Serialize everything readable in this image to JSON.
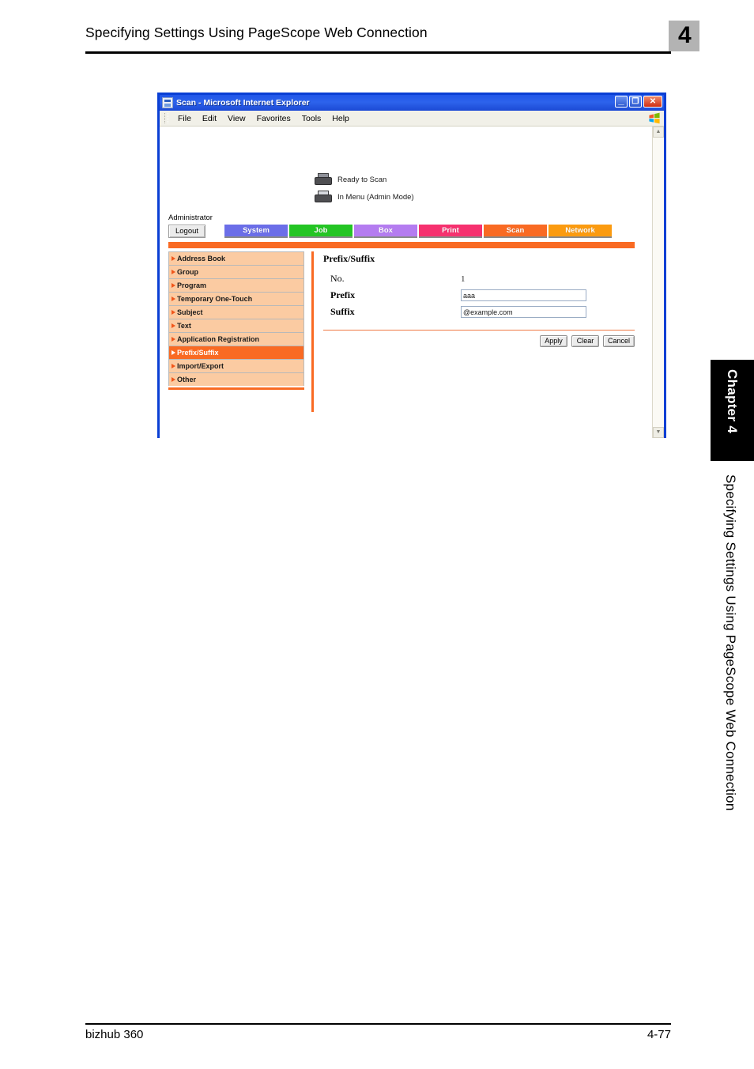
{
  "page": {
    "header_title": "Specifying Settings Using PageScope Web Connection",
    "chapter_number": "4",
    "side_tab_label": "Chapter 4",
    "side_vertical_label": "Specifying Settings Using PageScope Web Connection",
    "footer_left": "bizhub 360",
    "footer_right": "4-77"
  },
  "browser": {
    "title": "Scan - Microsoft Internet Explorer",
    "window_buttons": {
      "minimize": "_",
      "maximize": "❐",
      "close": "✕"
    },
    "menu": [
      {
        "label": "File"
      },
      {
        "label": "Edit"
      },
      {
        "label": "View"
      },
      {
        "label": "Favorites"
      },
      {
        "label": "Tools"
      },
      {
        "label": "Help"
      }
    ],
    "scroll_up": "▲",
    "scroll_down": "▼"
  },
  "webpage": {
    "status": [
      {
        "icon": "printer-icon",
        "text": "Ready to Scan"
      },
      {
        "icon": "scanner-icon",
        "text": "In Menu (Admin Mode)"
      }
    ],
    "admin_label": "Administrator",
    "logout_label": "Logout",
    "nav_tabs": [
      {
        "label": "System",
        "color": "#6b6ee8"
      },
      {
        "label": "Job",
        "color": "#24c524"
      },
      {
        "label": "Box",
        "color": "#b47cf0"
      },
      {
        "label": "Print",
        "color": "#f6316f"
      },
      {
        "label": "Scan",
        "color": "#f96a23"
      },
      {
        "label": "Network",
        "color": "#fb9b10"
      }
    ],
    "sidebar": [
      {
        "label": "Address Book",
        "active": false
      },
      {
        "label": "Group",
        "active": false
      },
      {
        "label": "Program",
        "active": false
      },
      {
        "label": "Temporary One-Touch",
        "active": false
      },
      {
        "label": "Subject",
        "active": false
      },
      {
        "label": "Text",
        "active": false
      },
      {
        "label": "Application Registration",
        "active": false
      },
      {
        "label": "Prefix/Suffix",
        "active": true
      },
      {
        "label": "Import/Export",
        "active": false
      },
      {
        "label": "Other",
        "active": false
      }
    ],
    "content": {
      "title": "Prefix/Suffix",
      "fields": [
        {
          "label": "No.",
          "type": "static",
          "value": "1"
        },
        {
          "label": "Prefix",
          "type": "input",
          "value": "aaa"
        },
        {
          "label": "Suffix",
          "type": "input",
          "value": "@example.com"
        }
      ],
      "buttons": [
        {
          "label": "Apply"
        },
        {
          "label": "Clear"
        },
        {
          "label": "Cancel"
        }
      ]
    }
  },
  "colors": {
    "accent_orange": "#f96a23",
    "sidebar_bg": "#fbcba2",
    "titlebar_blue": "#0a3fd4"
  }
}
